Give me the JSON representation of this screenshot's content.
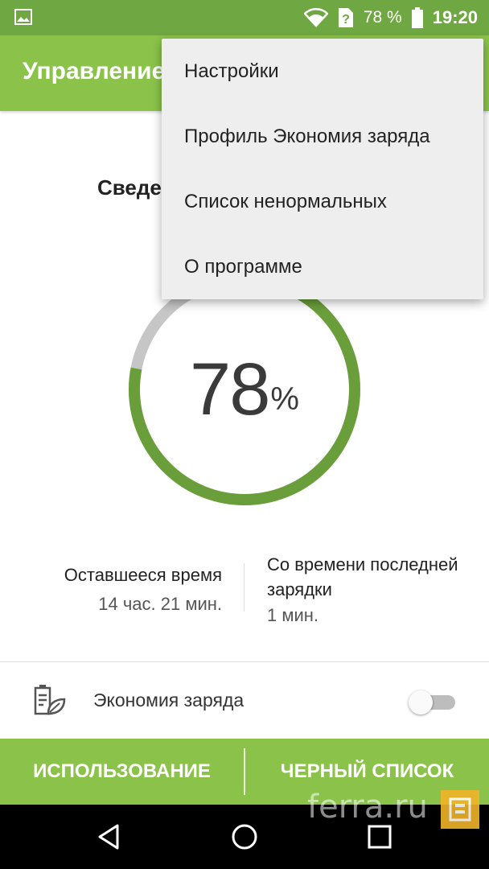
{
  "status_bar": {
    "battery_percent": "78 %",
    "time": "19:20",
    "icons": [
      "image-icon",
      "wifi-icon",
      "sim-unknown-icon",
      "battery-icon"
    ]
  },
  "app_bar": {
    "title": "Управление"
  },
  "main": {
    "section_title": "Сведе",
    "battery": {
      "value": "78",
      "unit": "%",
      "level": 0.78
    },
    "remaining": {
      "label": "Оставшееся время",
      "value": "14 час. 21 мин."
    },
    "since_charge": {
      "label": "Со времени последней зарядки",
      "value": "1 мин."
    },
    "eco": {
      "label": "Экономия заряда",
      "enabled": false
    }
  },
  "tabs": [
    "ИСПОЛЬЗОВАНИЕ",
    "ЧЕРНЫЙ СПИСОК"
  ],
  "menu": {
    "items": [
      "Настройки",
      "Профиль Экономия заряда",
      "Список ненормальных",
      "О программе"
    ]
  },
  "watermark": {
    "text": "ferra.ru"
  },
  "colors": {
    "status_bar": "#6fa842",
    "accent": "#8bc34a",
    "gauge_fill": "#6a9e3a",
    "gauge_track": "#c6c6c6"
  }
}
